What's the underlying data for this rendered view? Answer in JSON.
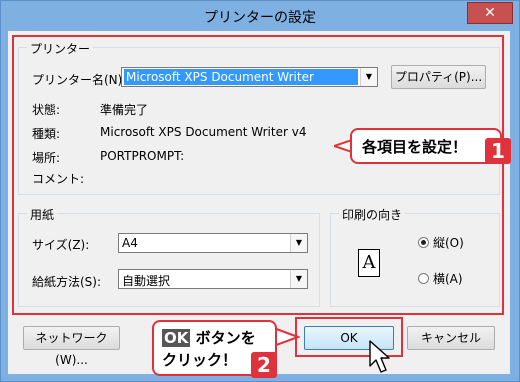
{
  "window": {
    "title": "プリンターの設定",
    "close_glyph": "✕"
  },
  "printer_group": {
    "label": "プリンター",
    "name_label": "プリンター名(N):",
    "name_value": "Microsoft XPS Document Writer",
    "properties_button": "プロパティ(P)...",
    "status_label": "状態:",
    "status_value": "準備完了",
    "type_label": "種類:",
    "type_value": "Microsoft XPS Document Writer v4",
    "location_label": "場所:",
    "location_value": "PORTPROMPT:",
    "comment_label": "コメント:",
    "comment_value": ""
  },
  "paper_group": {
    "label": "用紙",
    "size_label": "サイズ(Z):",
    "size_value": "A4",
    "source_label": "給紙方法(S):",
    "source_value": "自動選択"
  },
  "orientation_group": {
    "label": "印刷の向き",
    "preview_glyph": "A",
    "portrait_label": "縦(O)",
    "landscape_label": "横(A)",
    "portrait_selected": true
  },
  "buttons": {
    "network": "ネットワーク(W)...",
    "ok": "OK",
    "cancel": "キャンセル"
  },
  "annotations": {
    "callout1_text": "各項目を設定！",
    "callout1_num": "1",
    "callout2_line1_a": "OK",
    "callout2_line1_b": " ボタンを",
    "callout2_line2": "クリック！",
    "callout2_num": "2"
  },
  "colors": {
    "accent_red": "#e0323c",
    "selection_blue": "#3399ff",
    "title_bar": "#7fb0e2"
  }
}
